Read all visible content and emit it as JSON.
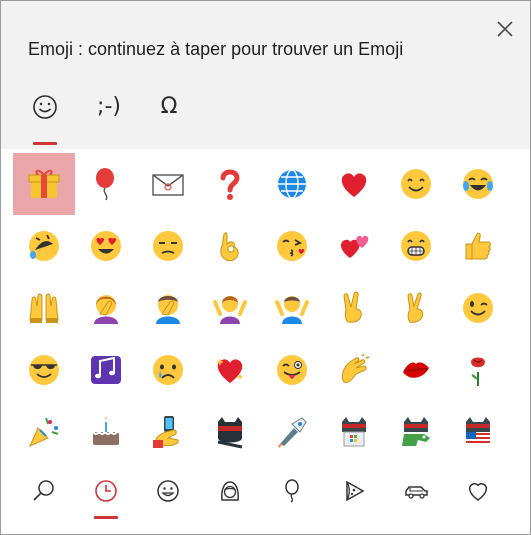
{
  "title": "Emoji : continuez à taper pour trouver un Emoji",
  "close_icon": "close-icon",
  "modes": [
    {
      "name": "emoji",
      "label": "☺",
      "active": true
    },
    {
      "name": "kaomoji",
      "label": ";-)",
      "active": false
    },
    {
      "name": "symbols",
      "label": "Ω",
      "active": false
    }
  ],
  "emojis": [
    [
      "wrapped-gift",
      "balloon",
      "envelope",
      "red-question-mark",
      "globe-with-meridians",
      "red-heart",
      "smiling-face",
      "face-with-tears-of-joy"
    ],
    [
      "rolling-on-the-floor-laughing",
      "smiling-face-with-heart-eyes",
      "unamused-face",
      "ok-hand",
      "face-blowing-a-kiss",
      "two-hearts",
      "beaming-face",
      "thumbs-up"
    ],
    [
      "raising-hands",
      "person-facepalming",
      "man-facepalming",
      "person-shrugging",
      "man-shrugging",
      "victory-hand",
      "crossed-fingers",
      "winking-face"
    ],
    [
      "smiling-face-with-sunglasses",
      "musical-notes",
      "crying-face",
      "sparkling-heart",
      "winking-face-with-tongue",
      "clapping-hands",
      "kiss-mark",
      "rose"
    ],
    [
      "party-popper",
      "birthday-cake",
      "selfie",
      "ninja",
      "ninja-flying",
      "ninja-gift",
      "ninja-dragon",
      "ninja-usa"
    ]
  ],
  "categories": [
    {
      "name": "search-icon",
      "active": false
    },
    {
      "name": "recent-clock-icon",
      "active": true
    },
    {
      "name": "smiley-faces-icon",
      "active": false
    },
    {
      "name": "people-icon",
      "active": false
    },
    {
      "name": "celebration-balloon-icon",
      "active": false
    },
    {
      "name": "food-pizza-icon",
      "active": false
    },
    {
      "name": "transport-car-icon",
      "active": false
    },
    {
      "name": "heart-symbols-icon",
      "active": false
    }
  ],
  "colors": {
    "accent": "#d13438",
    "header_bg": "#f2f2f2",
    "selection": "#eaa7aa"
  }
}
